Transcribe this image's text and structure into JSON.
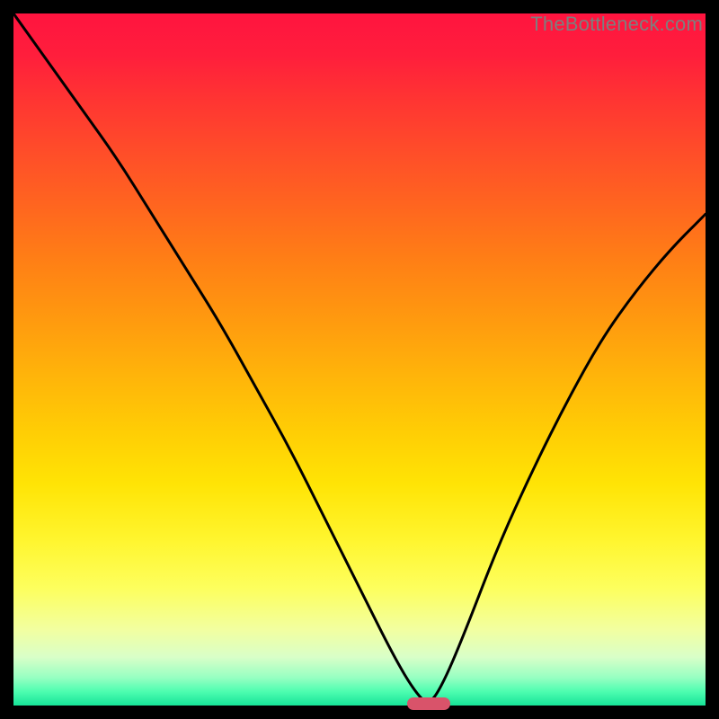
{
  "watermark": "TheBottleneck.com",
  "chart_data": {
    "type": "line",
    "title": "",
    "xlabel": "",
    "ylabel": "",
    "xlim": [
      0,
      100
    ],
    "ylim": [
      0,
      100
    ],
    "series": [
      {
        "name": "bottleneck-curve",
        "x": [
          0,
          5,
          10,
          15,
          20,
          25,
          30,
          35,
          40,
          45,
          50,
          55,
          58,
          60,
          62,
          65,
          70,
          75,
          80,
          85,
          90,
          95,
          100
        ],
        "values": [
          100,
          93,
          86,
          79,
          71,
          63,
          55,
          46,
          37,
          27,
          17,
          7,
          2,
          0,
          3,
          10,
          23,
          34,
          44,
          53,
          60,
          66,
          71
        ]
      }
    ],
    "minimum_point": {
      "x": 60,
      "y": 0
    },
    "marker": {
      "center_x_pct": 60,
      "bottom_y_pct": 0,
      "color": "#d9536a"
    },
    "background_gradient": {
      "type": "vertical",
      "stops": [
        {
          "pos": 0.0,
          "color": "#ff143f"
        },
        {
          "pos": 0.5,
          "color": "#ffb30a"
        },
        {
          "pos": 0.8,
          "color": "#fdff5d"
        },
        {
          "pos": 1.0,
          "color": "#16e398"
        }
      ]
    }
  }
}
